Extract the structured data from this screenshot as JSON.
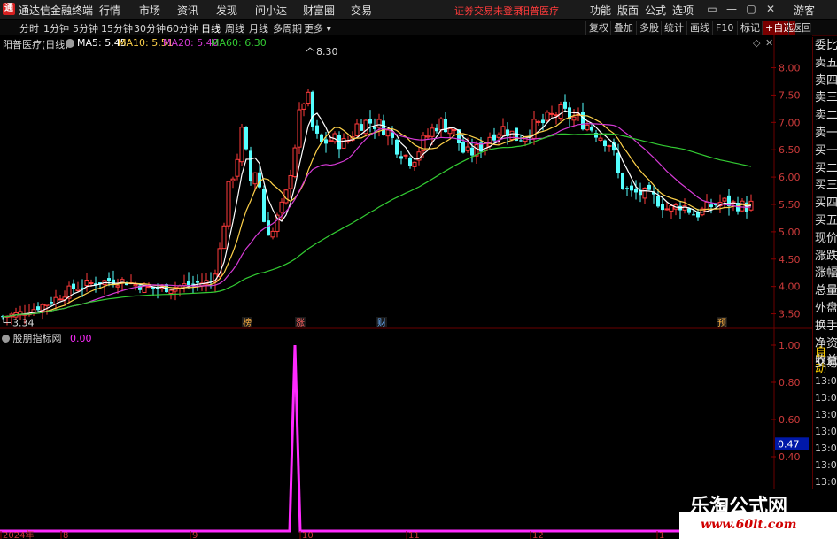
{
  "app": {
    "title": "通达信金融终端",
    "logo_char": "通",
    "menu": [
      "行情",
      "市场",
      "资讯",
      "发现",
      "问小达",
      "财富圈",
      "交易"
    ],
    "status_warning": "证券交易未登录",
    "status_stock": "阳普医疗",
    "right_menu": [
      "功能",
      "版面",
      "公式",
      "选项"
    ],
    "user": "游客",
    "window_buttons": [
      "▭",
      "—",
      "▢",
      "✕"
    ]
  },
  "periods": [
    "分时",
    "1分钟",
    "5分钟",
    "15分钟",
    "30分钟",
    "60分钟",
    "日线",
    "周线",
    "月线",
    "多周期",
    "更多 ▾"
  ],
  "active_period": "日线",
  "toolbar_buttons": [
    "复权",
    "叠加",
    "多股",
    "统计",
    "画线",
    "F10",
    "标记",
    "+自选",
    "返回"
  ],
  "chart_info": {
    "stock_label": "阳普医疗(日线)",
    "ma5": "MA5: 5.45",
    "ma10": "MA10: 5.51",
    "ma20": "MA20: 5.48",
    "ma60": "MA60: 6.30"
  },
  "colors": {
    "up": "#ff3b3b",
    "down": "#54ffff",
    "ma5": "#ffffff",
    "ma10": "#ffd24a",
    "ma20": "#d63ad6",
    "ma60": "#33cc33",
    "indicator": "#ff2aff"
  },
  "chart_data": [
    {
      "type": "candlestick",
      "title": "",
      "y_ticks": [
        "8.00",
        "7.50",
        "7.00",
        "6.50",
        "6.00",
        "5.50",
        "5.00",
        "4.50",
        "4.00",
        "3.50"
      ],
      "ylim": [
        3.25,
        8.3
      ],
      "high_label": "8.30",
      "low_label": "3.34",
      "event_markers": [
        "榜",
        "涨",
        "财",
        "预"
      ],
      "x_month_labels": [
        "2024年",
        "8",
        "9",
        "10",
        "11",
        "12",
        "1"
      ],
      "series": [
        {
          "name": "MA5",
          "value": 5.45
        },
        {
          "name": "MA10",
          "value": 5.51
        },
        {
          "name": "MA20",
          "value": 5.48
        },
        {
          "name": "MA60",
          "value": 6.3
        }
      ]
    },
    {
      "type": "line",
      "title": "股朋指标网",
      "current_value": "0.00",
      "y_ticks": [
        "1.00",
        "0.80",
        "0.60",
        "0.40",
        "0.20"
      ],
      "ylim": [
        0,
        1.0
      ],
      "cursor_value": "0.47",
      "spike_value": 1.0
    }
  ],
  "right_panel": {
    "items": [
      "委比",
      "卖五",
      "卖四",
      "卖三",
      "卖二",
      "卖一",
      "买一",
      "买二",
      "买三",
      "买四",
      "买五",
      "现价",
      "涨跌",
      "涨幅",
      "总量",
      "外盘",
      "换手",
      "净资",
      "收益"
    ],
    "auto_label": "自动",
    "trade_label": "交易",
    "times": [
      "13:04",
      "13:04",
      "13:04",
      "13:04",
      "13:05",
      "13:05",
      "13:05",
      "13:05"
    ]
  },
  "watermark": {
    "title": "乐淘公式网",
    "url": "www.60lt.com"
  }
}
